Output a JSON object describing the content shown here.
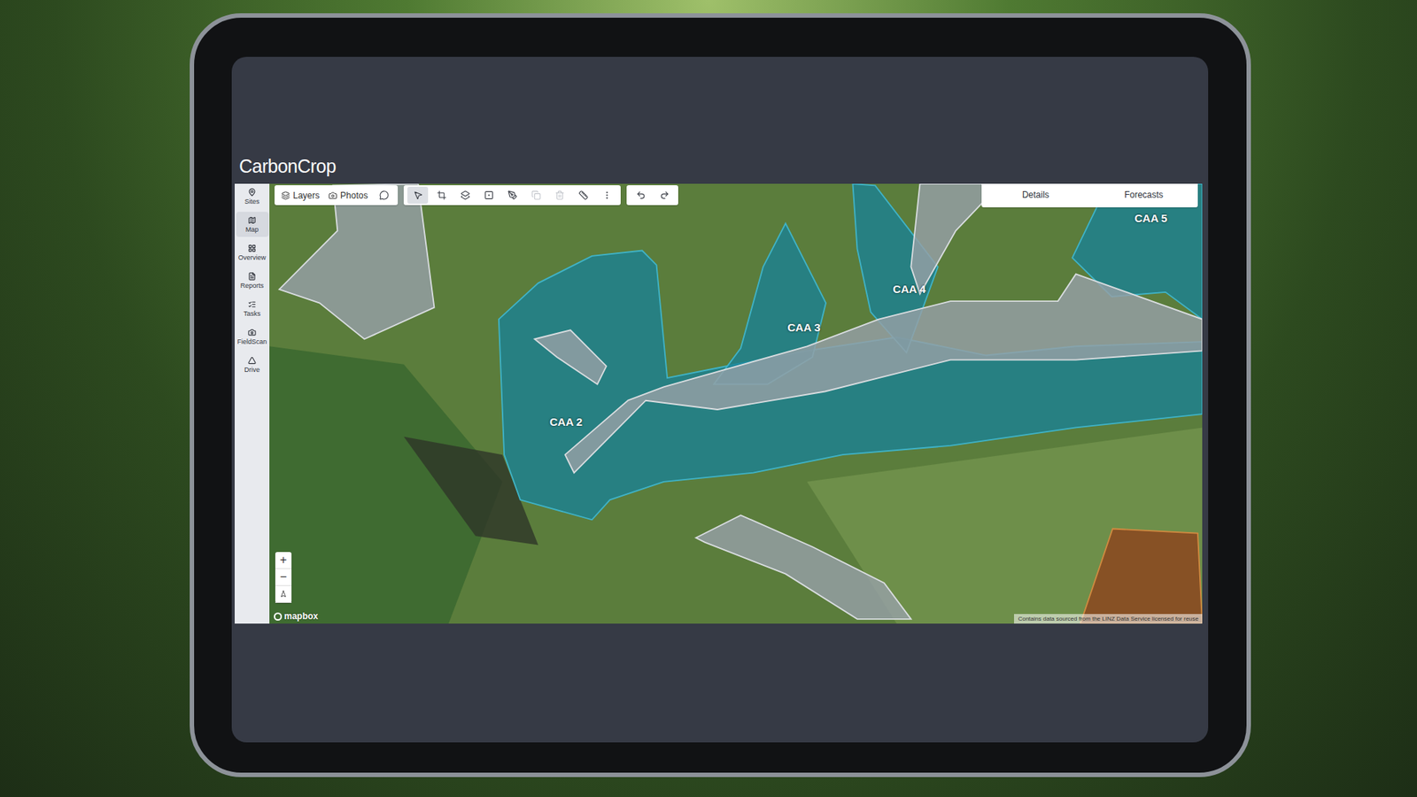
{
  "brand": {
    "logo": "CarbonCrop"
  },
  "sidebar": {
    "items": [
      {
        "label": "Sites",
        "selected": false
      },
      {
        "label": "Map",
        "selected": true
      },
      {
        "label": "Overview",
        "selected": false
      },
      {
        "label": "Reports",
        "selected": false
      },
      {
        "label": "Tasks",
        "selected": false
      },
      {
        "label": "FieldScan",
        "selected": false
      },
      {
        "label": "Drive",
        "selected": false
      }
    ]
  },
  "toolbar": {
    "layers": "Layers",
    "photos": "Photos",
    "tools": [
      {
        "selected": true,
        "disabled": false
      },
      {
        "selected": false,
        "disabled": false
      },
      {
        "selected": false,
        "disabled": false
      },
      {
        "selected": false,
        "disabled": false
      },
      {
        "selected": false,
        "disabled": false
      },
      {
        "selected": false,
        "disabled": true
      },
      {
        "selected": false,
        "disabled": true
      },
      {
        "selected": false,
        "disabled": false
      },
      {
        "selected": false,
        "disabled": false
      }
    ],
    "history": [
      {
        "disabled": false
      },
      {
        "disabled": false
      }
    ]
  },
  "panel_tabs": [
    {
      "label": "Details",
      "selected": false
    },
    {
      "label": "Forecasts",
      "selected": false
    }
  ],
  "map": {
    "areas": [
      {
        "label": "CAA 2"
      },
      {
        "label": "CAA 3"
      },
      {
        "label": "CAA 4"
      },
      {
        "label": "CAA 5"
      }
    ],
    "zoom": {
      "in": "+",
      "out": "−"
    },
    "logo": "mapbox",
    "attribution": "Contains data sourced from the LINZ Data Service licensed for reuse"
  }
}
